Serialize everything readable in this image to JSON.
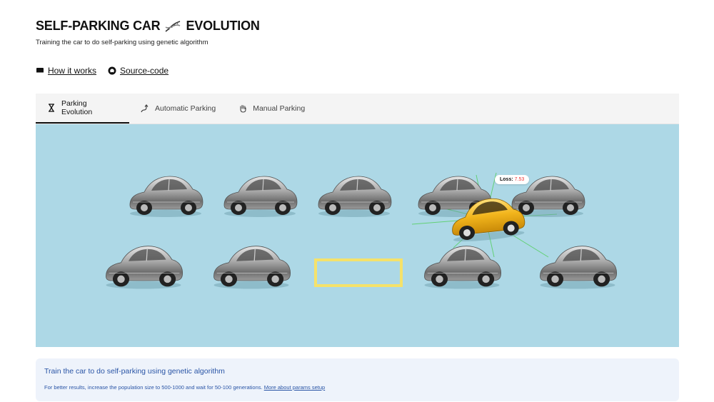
{
  "header": {
    "title_left": "SELF-PARKING CAR",
    "title_right": "EVOLUTION",
    "subtitle": "Training the car to do self-parking using genetic algorithm"
  },
  "links": {
    "how_it_works": "How it works",
    "source_code": "Source-code"
  },
  "tabs": [
    {
      "label": "Parking Evolution",
      "icon": "hourglass-icon",
      "active": true
    },
    {
      "label": "Automatic Parking",
      "icon": "route-icon",
      "active": false
    },
    {
      "label": "Manual Parking",
      "icon": "hand-icon",
      "active": false
    }
  ],
  "scene": {
    "loss_label": "Loss:",
    "loss_value": "7.53",
    "colors": {
      "background": "#add8e6",
      "parked_car": "#9a9a9a",
      "active_car": "#f2b51c",
      "parking_spot": "#f5e26a",
      "sensor_line": "#5bd06a"
    }
  },
  "info": {
    "line1": "Train the car to do self-parking using genetic algorithm",
    "line2_text": "For better results, increase the population size to 500-1000 and wait for 50-100 generations.",
    "line2_link": "More about params setup"
  }
}
